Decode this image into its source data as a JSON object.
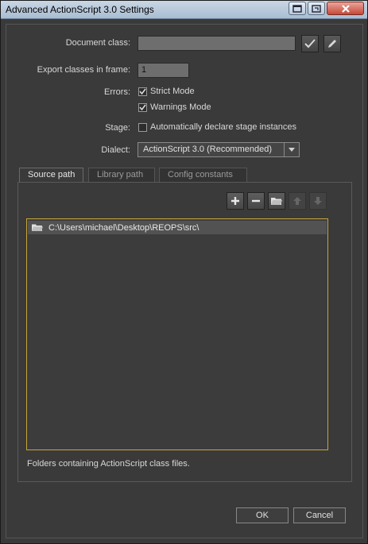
{
  "window": {
    "title": "Advanced ActionScript 3.0 Settings"
  },
  "form": {
    "document_class_label": "Document class:",
    "document_class_value": "",
    "export_frame_label": "Export classes in frame:",
    "export_frame_value": "1",
    "errors_label": "Errors:",
    "strict_mode_label": "Strict Mode",
    "strict_mode_checked": true,
    "warnings_mode_label": "Warnings Mode",
    "warnings_mode_checked": true,
    "stage_label": "Stage:",
    "auto_declare_label": "Automatically declare stage instances",
    "auto_declare_checked": false,
    "dialect_label": "Dialect:",
    "dialect_value": "ActionScript 3.0 (Recommended)"
  },
  "tabs": [
    {
      "label": "Source path",
      "active": true
    },
    {
      "label": "Library path",
      "active": false
    },
    {
      "label": "Config constants",
      "active": false
    }
  ],
  "source_path": {
    "entries": [
      "C:\\Users\\michael\\Desktop\\REOPS\\src\\"
    ],
    "hint": "Folders containing ActionScript class files."
  },
  "buttons": {
    "ok": "OK",
    "cancel": "Cancel"
  },
  "colors": {
    "accent": "#c8a43a",
    "background": "#3a3a3a"
  }
}
